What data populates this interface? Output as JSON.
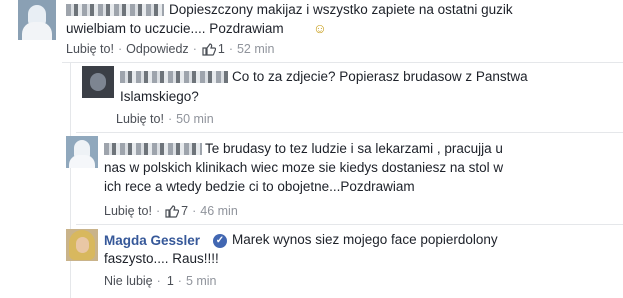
{
  "comments": [
    {
      "text_lines": [
        "Dopieszczony makijaz i wszystko zapiete na ostatni guzik",
        "uwielbiam to uczucie.... Pozdrawiam"
      ],
      "emoji": "☺",
      "like_label": "Lubię to!",
      "reply_label": "Odpowiedz",
      "likes": "1",
      "time": "52 min"
    },
    {
      "text_lines": [
        "Co to za zdjecie? Popierasz brudasow z Panstwa",
        "Islamskiego?"
      ],
      "like_label": "Lubię to!",
      "time": "50 min"
    },
    {
      "text_lines": [
        "Te brudasy to tez ludzie i sa lekarzami , pracujja u",
        "nas w polskich klinikach wiec moze sie kiedys dostaniesz na stol w",
        "ich rece a wtedy bedzie ci to obojetne...Pozdrawiam"
      ],
      "like_label": "Lubię to!",
      "likes": "7",
      "time": "46 min"
    },
    {
      "author": "Magda Gessler",
      "verified_mark": "✓",
      "text_lines": [
        "Marek wynos siez mojego face popierdolony",
        "faszysto.... Raus!!!!"
      ],
      "like_label": "Nie lubię",
      "likes": "1",
      "time": "5 min"
    }
  ],
  "separator": "·"
}
